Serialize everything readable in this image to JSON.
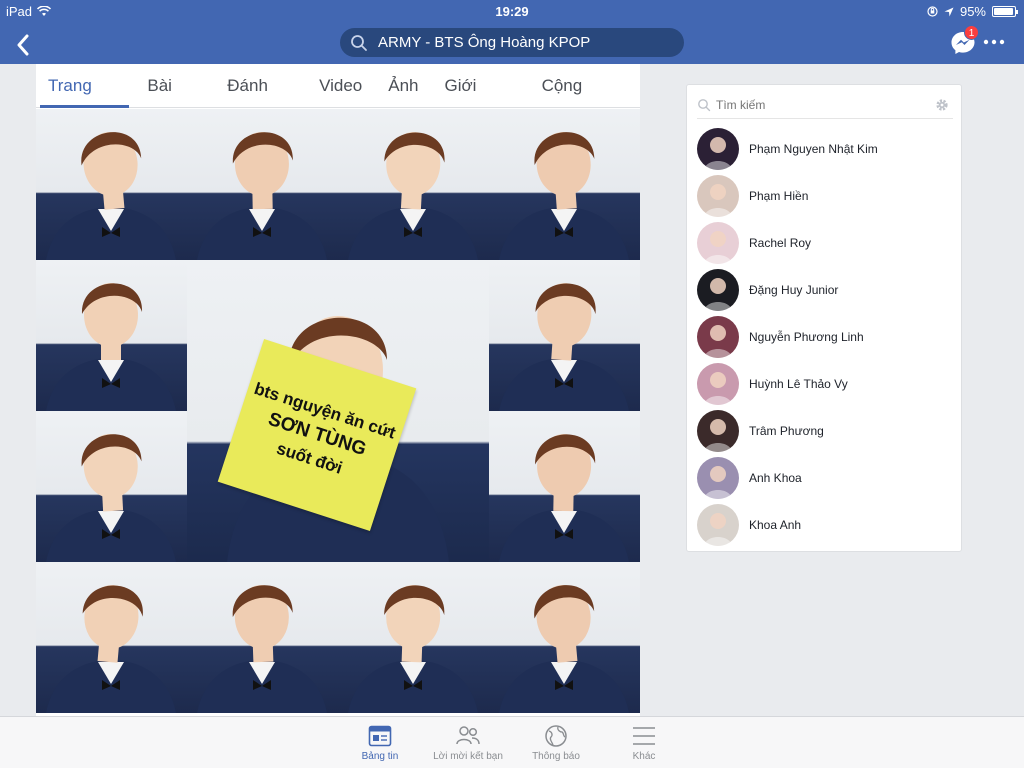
{
  "status_bar": {
    "device": "iPad",
    "time": "19:29",
    "battery_percent": "95%",
    "battery_level": 0.95
  },
  "nav": {
    "search_text": "ARMY - BTS Ông Hoàng KPOP",
    "messenger_badge": "1"
  },
  "tabs": [
    {
      "label": "Trang chủ",
      "active": true
    },
    {
      "label": "Bài viết",
      "active": false
    },
    {
      "label": "Đánh giá",
      "active": false
    },
    {
      "label": "Video",
      "active": false
    },
    {
      "label": "Ảnh",
      "active": false
    },
    {
      "label": "Giới thiệu",
      "active": false
    },
    {
      "label": "Cộng đồng",
      "active": false
    }
  ],
  "cover": {
    "sign_line1": "bts nguyện ăn cứt",
    "sign_line2": "SƠN TÙNG",
    "sign_line3": "suốt đời"
  },
  "sidebar": {
    "search_placeholder": "Tìm kiếm",
    "contacts": [
      {
        "name": "Phạm Nguyen Nhật Kim",
        "color": "#2b2035"
      },
      {
        "name": "Phạm Hiền",
        "color": "#d9c7bd"
      },
      {
        "name": "Rachel Roy",
        "color": "#e8cfd6"
      },
      {
        "name": "Đặng Huy Junior",
        "color": "#1b1c22"
      },
      {
        "name": "Nguyễn Phương Linh",
        "color": "#7a3a4a"
      },
      {
        "name": "Huỳnh Lê Thảo Vy",
        "color": "#c99aae"
      },
      {
        "name": "Trâm Phương",
        "color": "#3b2a2a"
      },
      {
        "name": "Anh Khoa",
        "color": "#9a8fb0"
      },
      {
        "name": "Khoa Anh",
        "color": "#d8d2cc"
      }
    ]
  },
  "bottom_tabs": [
    {
      "label": "Bảng tin",
      "icon": "news-feed-icon",
      "active": true
    },
    {
      "label": "Lời mời kết bạn",
      "icon": "friend-requests-icon",
      "active": false
    },
    {
      "label": "Thông báo",
      "icon": "notifications-globe-icon",
      "active": false
    },
    {
      "label": "Khác",
      "icon": "menu-icon",
      "active": false
    }
  ],
  "colors": {
    "brand": "#4267b2",
    "badge": "#fa3e3e"
  }
}
